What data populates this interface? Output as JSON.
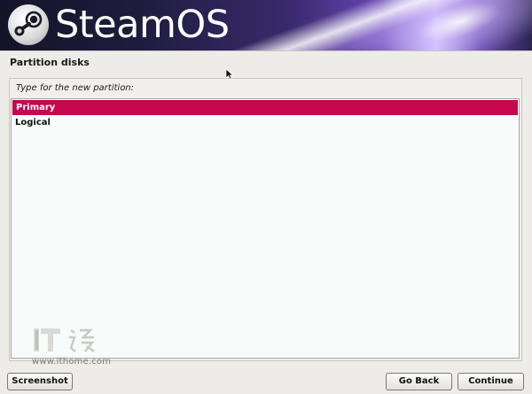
{
  "header": {
    "logo_text": "SteamOS",
    "logo_icon": "steam-logo-icon"
  },
  "page": {
    "title": "Partition disks",
    "prompt": "Type for the new partition:"
  },
  "options": {
    "items": [
      {
        "label": "Primary",
        "selected": true
      },
      {
        "label": "Logical",
        "selected": false
      }
    ]
  },
  "watermark": {
    "url": "www.ithome.com"
  },
  "buttons": {
    "screenshot": "Screenshot",
    "go_back": "Go Back",
    "continue": "Continue"
  },
  "colors": {
    "selection": "#c8054f",
    "background": "#edece8",
    "list_background": "#f7fbf9"
  }
}
